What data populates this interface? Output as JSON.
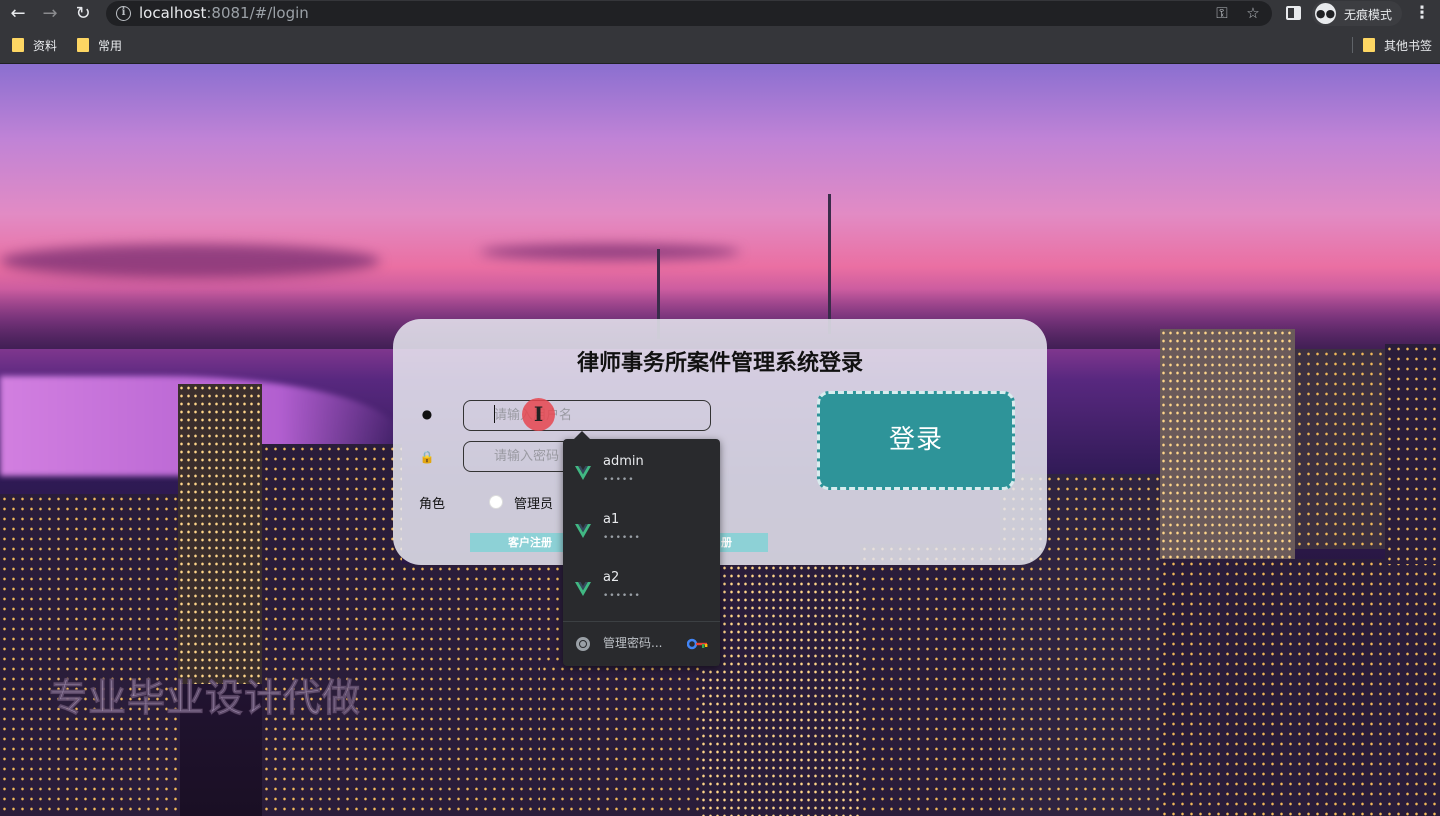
{
  "browser": {
    "url_host": "localhost",
    "url_rest": ":8081/#/login",
    "incognito_label": "无痕模式",
    "bookmarks": [
      "资料",
      "常用"
    ],
    "other_bookmarks": "其他书签"
  },
  "login": {
    "title": "律师事务所案件管理系统登录",
    "username_placeholder": "请输入用户名",
    "password_placeholder": "请输入密码",
    "role_label": "角色",
    "role_option": "管理员",
    "register_customer": "客户注册",
    "register_other": "册",
    "login_button": "登录"
  },
  "autofill": {
    "accounts": [
      {
        "username": "admin",
        "password_mask": "•••••"
      },
      {
        "username": "a1",
        "password_mask": "••••••"
      },
      {
        "username": "a2",
        "password_mask": "••••••"
      }
    ],
    "manage_label": "管理密码..."
  },
  "watermark": "专业毕业设计代做",
  "colors": {
    "accent": "#2e9499",
    "register_button": "#8dd1d6",
    "vue_green": "#41b883"
  }
}
